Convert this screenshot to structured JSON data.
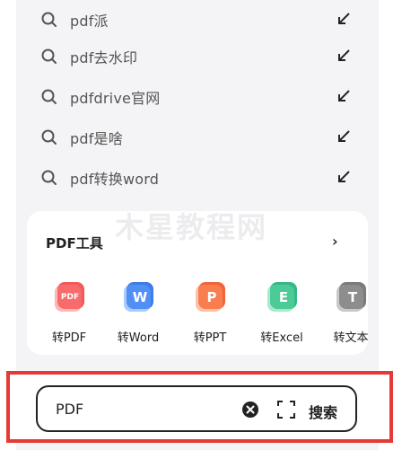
{
  "suggestions": [
    {
      "text": "pdf派"
    },
    {
      "text": "pdf去水印"
    },
    {
      "text": "pdfdrive官网"
    },
    {
      "text": "pdf是啥"
    },
    {
      "text": "pdf转换word"
    }
  ],
  "watermark": "木星教程网",
  "tools": {
    "title": "PDF工具",
    "more": "›",
    "items": [
      {
        "label": "转PDF",
        "badge": "PDF",
        "color": "#f05a5a"
      },
      {
        "label": "转Word",
        "badge": "W",
        "color": "#3e7ce6"
      },
      {
        "label": "转PPT",
        "badge": "P",
        "color": "#f0663a"
      },
      {
        "label": "转Excel",
        "badge": "E",
        "color": "#35b886"
      },
      {
        "label": "转文本",
        "badge": "T",
        "color": "#7b7b7b"
      }
    ]
  },
  "search_bar": {
    "query": "PDF",
    "submit_label": "搜索"
  },
  "colors": {
    "highlight": "#e53935",
    "background": "#f4f4f6"
  }
}
